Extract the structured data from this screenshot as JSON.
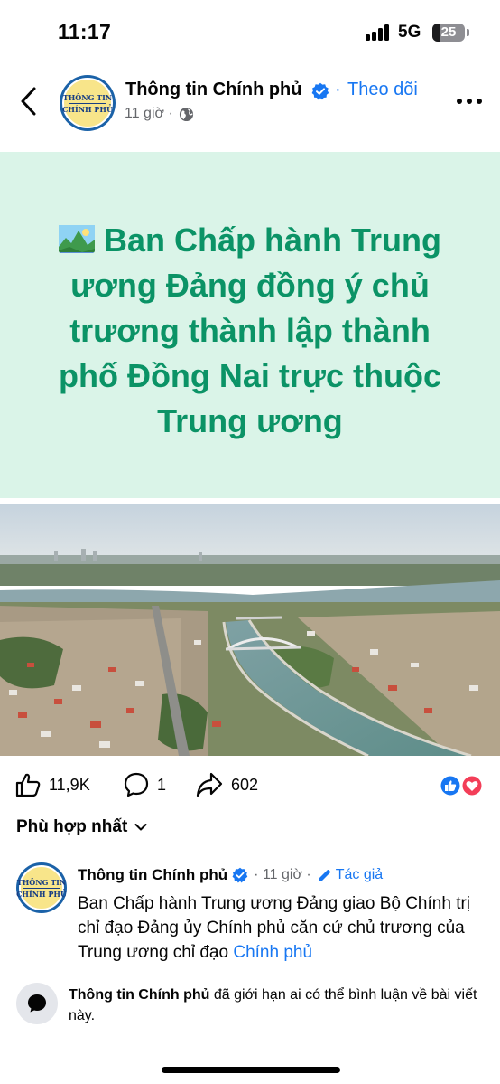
{
  "status_bar": {
    "time": "11:17",
    "network": "5G",
    "battery": "25",
    "battery_level": 0.25
  },
  "header": {
    "page_name": "Thông tin Chính phủ",
    "dot": "·",
    "follow_label": "Theo dõi",
    "time_ago": "11 giờ ·",
    "avatar_text_line1": "THÔNG TIN",
    "avatar_text_line2": "CHÍNH PHỦ"
  },
  "post": {
    "banner_title": "Ban Chấp hành Trung ương Đảng đồng ý chủ trương thành lập thành phố Đồng Nai trực thuộc Trung ương",
    "banner_bg": "#daf4e8",
    "banner_text_color": "#0b9366"
  },
  "actions": {
    "likes": "11,9K",
    "comments": "1",
    "shares": "602"
  },
  "sort": {
    "label": "Phù hợp nhất"
  },
  "comment": {
    "author": "Thông tin Chính phủ",
    "time": "· 11 giờ ·",
    "author_badge": "Tác giả",
    "text": "Ban Chấp hành Trung ương Đảng giao Bộ Chính trị chỉ đạo Đảng ủy Chính phủ căn cứ chủ trương của Trung ương chỉ đạo ",
    "link_text": "Chính phủ"
  },
  "footer": {
    "name": "Thông tin Chính phủ",
    "message": " đã giới hạn ai có thể bình luận về bài viết này."
  },
  "colors": {
    "accent": "#1877f2",
    "banner_text": "#0b9366"
  }
}
